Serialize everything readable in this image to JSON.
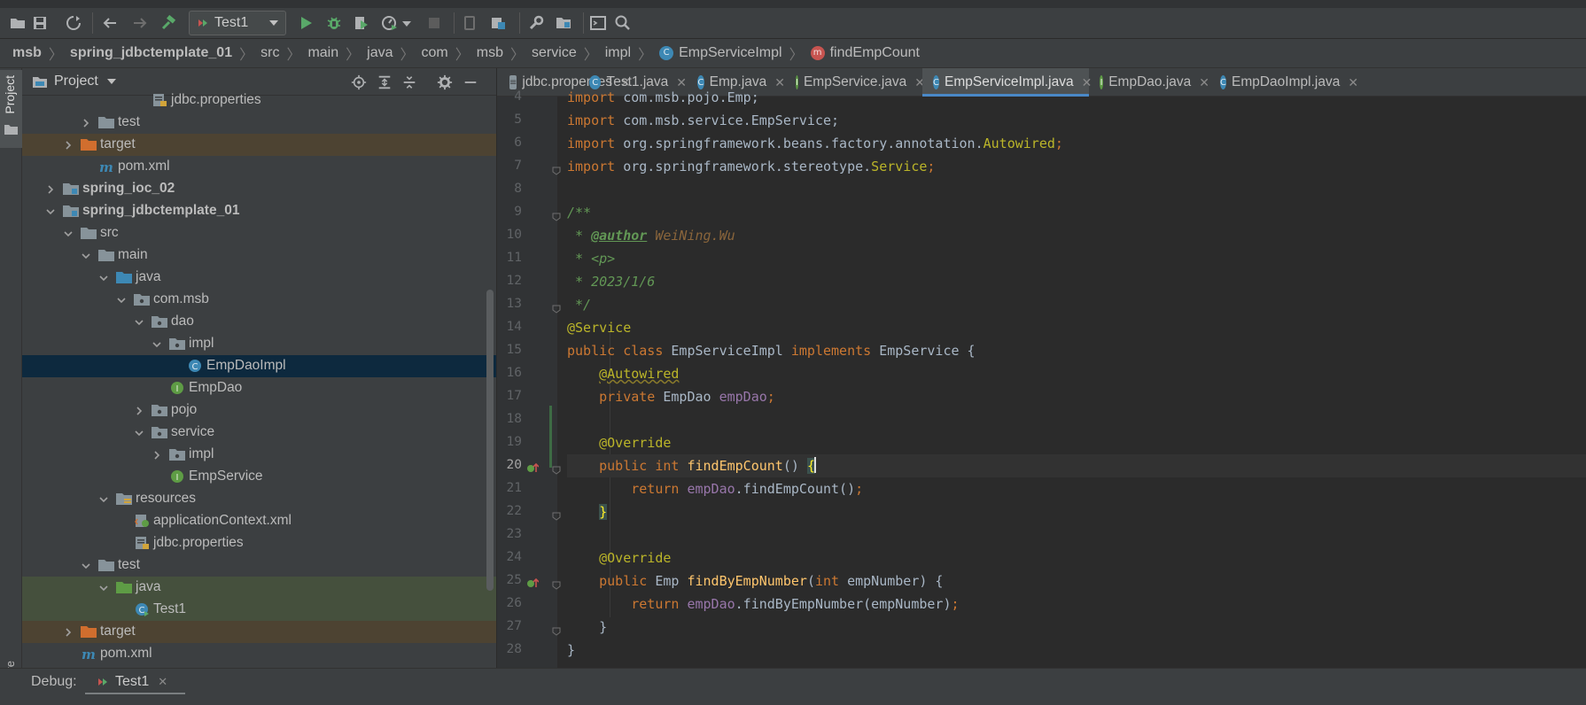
{
  "toolbar": {
    "run_config": "Test1",
    "icons": [
      "open-folder-icon",
      "save-icon",
      "sync-icon",
      "back-icon",
      "forward-icon",
      "build-hammer-icon",
      "run-icon",
      "debug-icon",
      "run-with-coverage-icon",
      "profile-icon",
      "more-run-options-icon",
      "stop-icon",
      "device-icon",
      "jar-icon",
      "settings-wrench-icon",
      "project-structure-icon",
      "terminal-icon",
      "search-icon"
    ]
  },
  "breadcrumb": {
    "items": [
      "msb",
      "spring_jdbctemplate_01",
      "src",
      "main",
      "java",
      "com",
      "msb",
      "service",
      "impl",
      "EmpServiceImpl",
      "findEmpCount"
    ]
  },
  "left_strip": {
    "project_label": "Project",
    "structure_label": "ucture"
  },
  "project_panel": {
    "title": "Project",
    "tree": [
      {
        "label": "jdbc.properties",
        "kind": "properties"
      },
      {
        "label": "test",
        "kind": "folder",
        "arrow": "right"
      },
      {
        "label": "target",
        "kind": "folder-orange",
        "arrow": "right",
        "highlight": "target"
      },
      {
        "label": "pom.xml",
        "kind": "maven"
      },
      {
        "label": "spring_ioc_02",
        "kind": "module",
        "arrow": "right",
        "bold": true
      },
      {
        "label": "spring_jdbctemplate_01",
        "kind": "module",
        "arrow": "down",
        "bold": true
      },
      {
        "label": "src",
        "kind": "folder",
        "arrow": "down"
      },
      {
        "label": "main",
        "kind": "folder",
        "arrow": "down"
      },
      {
        "label": "java",
        "kind": "folder-blue",
        "arrow": "down"
      },
      {
        "label": "com.msb",
        "kind": "package",
        "arrow": "down"
      },
      {
        "label": "dao",
        "kind": "package",
        "arrow": "down"
      },
      {
        "label": "impl",
        "kind": "package",
        "arrow": "down"
      },
      {
        "label": "EmpDaoImpl",
        "kind": "class",
        "selected": true
      },
      {
        "label": "EmpDao",
        "kind": "interface"
      },
      {
        "label": "pojo",
        "kind": "package",
        "arrow": "right"
      },
      {
        "label": "service",
        "kind": "package",
        "arrow": "down"
      },
      {
        "label": "impl",
        "kind": "package",
        "arrow": "right"
      },
      {
        "label": "EmpService",
        "kind": "interface"
      },
      {
        "label": "resources",
        "kind": "folder-res",
        "arrow": "down"
      },
      {
        "label": "applicationContext.xml",
        "kind": "xml"
      },
      {
        "label": "jdbc.properties",
        "kind": "properties"
      },
      {
        "label": "test",
        "kind": "folder",
        "arrow": "down"
      },
      {
        "label": "java",
        "kind": "folder-green",
        "arrow": "down",
        "highlight": "test"
      },
      {
        "label": "Test1",
        "kind": "test-class",
        "highlight": "test"
      },
      {
        "label": "target",
        "kind": "folder-orange",
        "arrow": "right",
        "highlight": "target"
      },
      {
        "label": "pom.xml",
        "kind": "maven"
      }
    ]
  },
  "editor": {
    "tabs": [
      {
        "label": "jdbc.properties",
        "icon": "properties"
      },
      {
        "label": "Test1.java",
        "icon": "test-class"
      },
      {
        "label": "Emp.java",
        "icon": "class"
      },
      {
        "label": "EmpService.java",
        "icon": "interface"
      },
      {
        "label": "EmpServiceImpl.java",
        "icon": "class",
        "active": true
      },
      {
        "label": "EmpDao.java",
        "icon": "interface"
      },
      {
        "label": "EmpDaoImpl.java",
        "icon": "class"
      }
    ],
    "line_numbers": [
      "4",
      "5",
      "6",
      "7",
      "8",
      "9",
      "10",
      "11",
      "12",
      "13",
      "14",
      "15",
      "16",
      "17",
      "18",
      "19",
      "20",
      "21",
      "22",
      "23",
      "24",
      "25",
      "26",
      "27",
      "28"
    ],
    "code": {
      "l4": "import com.msb.pojo.Emp;",
      "l5_kw": "import",
      "l5_rest": " com.msb.service.EmpService;",
      "l6_kw": "import",
      "l6_rest": " org.springframework.beans.factory.annotation.",
      "l6_cls": "Autowired",
      "l6_end": ";",
      "l7_kw": "import",
      "l7_rest": " org.springframework.stereotype.",
      "l7_cls": "Service",
      "l7_end": ";",
      "l9": "/**",
      "l10_pre": " * ",
      "l10_tag": "@author",
      "l10_val": " WeiNing.Wu",
      "l11": " * <p>",
      "l12": " * 2023/1/6",
      "l13": " */",
      "l14": "@Service",
      "l15_kw1": "public class",
      "l15_name": " EmpServiceImpl ",
      "l15_kw2": "implements",
      "l15_iface": " EmpService {",
      "l16_indent": "    ",
      "l16_ann": "@Autowired",
      "l17_indent": "    ",
      "l17_kw": "private",
      "l17_type": " EmpDao ",
      "l17_fld": "empDao",
      "l17_end": ";",
      "l19_indent": "    ",
      "l19_ann": "@Override",
      "l20_indent": "    ",
      "l20_kw": "public int",
      "l20_sp": " ",
      "l20_fn": "findEmpCount",
      "l20_paren": "() ",
      "l20_brace": "{",
      "l21_indent": "        ",
      "l21_kw": "return",
      "l21_sp": " ",
      "l21_fld": "empDao",
      "l21_call": ".findEmpCount()",
      "l21_end": ";",
      "l22_indent": "    ",
      "l22_brace": "}",
      "l24_indent": "    ",
      "l24_ann": "@Override",
      "l25_indent": "    ",
      "l25_kw": "public",
      "l25_type": " Emp ",
      "l25_fn": "findByEmpNumber",
      "l25_open": "(",
      "l25_kw2": "int",
      "l25_param": " empNumber) {",
      "l26_indent": "        ",
      "l26_kw": "return",
      "l26_sp": " ",
      "l26_fld": "empDao",
      "l26_call": ".findByEmpNumber(empNumber)",
      "l26_end": ";",
      "l27_indent": "    ",
      "l27_brace": "}",
      "l28": "}"
    }
  },
  "debug_bar": {
    "label": "Debug:",
    "tab": "Test1"
  },
  "colors": {
    "keyword": "#cc7832",
    "annotation": "#bbb529",
    "doc": "#629755",
    "field": "#9876aa",
    "method": "#ffc66d",
    "accent": "#4a88c7"
  }
}
